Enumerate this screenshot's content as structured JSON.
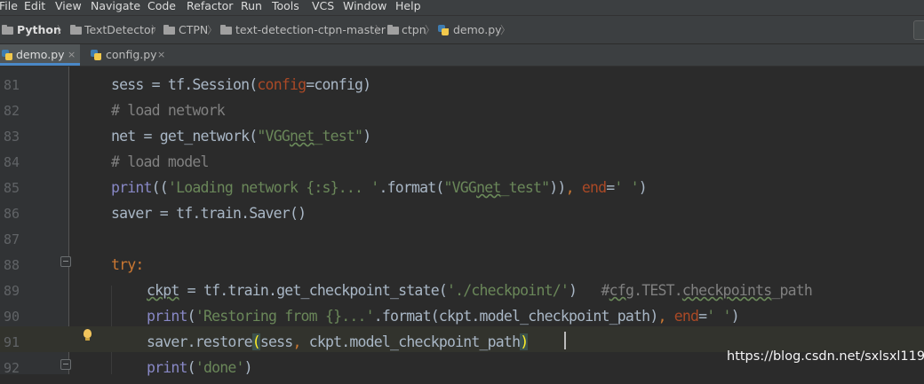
{
  "menu": [
    "File",
    "Edit",
    "View",
    "Navigate",
    "Code",
    "Refactor",
    "Run",
    "Tools",
    "VCS",
    "Window",
    "Help"
  ],
  "breadcrumbs": [
    "Python",
    "TextDetector",
    "CTPN",
    "text-detection-ctpn-master",
    "ctpn",
    "demo.py"
  ],
  "breadcrumb_separator": "〉",
  "tabs": [
    {
      "label": "demo.py",
      "active": true
    },
    {
      "label": "config.py",
      "active": false
    }
  ],
  "tab_close": "×",
  "editor": {
    "line_numbers": [
      "81",
      "82",
      "83",
      "84",
      "85",
      "86",
      "87",
      "88",
      "89",
      "90",
      "91",
      "92"
    ],
    "current_line": "91"
  },
  "watermark": "https://blog.csdn.net/sxlsxl119",
  "colors": {
    "background": "#2b2b2b",
    "keyword": "#cc7832",
    "string": "#6a8759",
    "comment": "#808080",
    "builtin": "#8888c6",
    "parameter": "#aa4926",
    "text": "#a9b7c6",
    "current_line": "#32332d"
  }
}
